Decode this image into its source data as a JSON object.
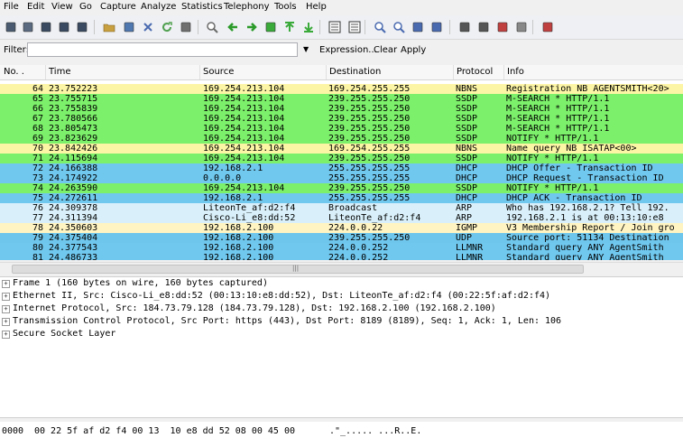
{
  "menu": [
    "File",
    "Edit",
    "View",
    "Go",
    "Capture",
    "Analyze",
    "Statistics",
    "Telephony",
    "Tools",
    "Help"
  ],
  "toolbar_icons": [
    "interfaces-icon",
    "options-icon",
    "start-capture-icon",
    "stop-capture-icon",
    "restart-capture-icon",
    "open-file-icon",
    "save-file-icon",
    "close-file-icon",
    "reload-icon",
    "print-icon",
    "find-packet-icon",
    "go-back-icon",
    "go-forward-icon",
    "go-to-packet-icon",
    "go-first-icon",
    "go-last-icon",
    "colorize-icon",
    "auto-scroll-icon",
    "zoom-in-icon",
    "zoom-out-icon",
    "normal-size-icon",
    "resize-columns-icon",
    "capture-filters-icon",
    "display-filters-icon",
    "coloring-rules-icon",
    "preferences-icon",
    "help-icon"
  ],
  "filter": {
    "label": "Filter:",
    "value": "",
    "expression_label": "Expression...",
    "clear_label": "Clear",
    "apply_label": "Apply"
  },
  "columns": {
    "no": "No. .",
    "time": "Time",
    "source": "Source",
    "destination": "Destination",
    "protocol": "Protocol",
    "info": "Info"
  },
  "colors": {
    "nbns": "#fdf5a6",
    "ssdp": "#7cf06a",
    "dhcp": "#70c8ef",
    "arp": "#d9f0fa",
    "igmp": "#fff4c2",
    "udp": "#6fc6ec",
    "llmnr": "#70c8ef",
    "partial": "#e8e8ff"
  },
  "packets": [
    {
      "no": "64",
      "time": "23.752223",
      "src": "169.254.213.104",
      "dst": "169.254.255.255",
      "proto": "NBNS",
      "info": "Registration NB AGENTSMITH<20>",
      "color": "#fdf5a6"
    },
    {
      "no": "65",
      "time": "23.755715",
      "src": "169.254.213.104",
      "dst": "239.255.255.250",
      "proto": "SSDP",
      "info": "M-SEARCH * HTTP/1.1",
      "color": "#7cf06a"
    },
    {
      "no": "66",
      "time": "23.755839",
      "src": "169.254.213.104",
      "dst": "239.255.255.250",
      "proto": "SSDP",
      "info": "M-SEARCH * HTTP/1.1",
      "color": "#7cf06a"
    },
    {
      "no": "67",
      "time": "23.780566",
      "src": "169.254.213.104",
      "dst": "239.255.255.250",
      "proto": "SSDP",
      "info": "M-SEARCH * HTTP/1.1",
      "color": "#7cf06a"
    },
    {
      "no": "68",
      "time": "23.805473",
      "src": "169.254.213.104",
      "dst": "239.255.255.250",
      "proto": "SSDP",
      "info": "M-SEARCH * HTTP/1.1",
      "color": "#7cf06a"
    },
    {
      "no": "69",
      "time": "23.823629",
      "src": "169.254.213.104",
      "dst": "239.255.255.250",
      "proto": "SSDP",
      "info": "NOTIFY * HTTP/1.1",
      "color": "#7cf06a"
    },
    {
      "no": "70",
      "time": "23.842426",
      "src": "169.254.213.104",
      "dst": "169.254.255.255",
      "proto": "NBNS",
      "info": "Name query NB ISATAP<00>",
      "color": "#fdf5a6"
    },
    {
      "no": "71",
      "time": "24.115694",
      "src": "169.254.213.104",
      "dst": "239.255.255.250",
      "proto": "SSDP",
      "info": "NOTIFY * HTTP/1.1",
      "color": "#7cf06a"
    },
    {
      "no": "72",
      "time": "24.166388",
      "src": "192.168.2.1",
      "dst": "255.255.255.255",
      "proto": "DHCP",
      "info": "DHCP Offer    - Transaction ID",
      "color": "#70c8ef"
    },
    {
      "no": "73",
      "time": "24.174922",
      "src": "0.0.0.0",
      "dst": "255.255.255.255",
      "proto": "DHCP",
      "info": "DHCP Request  - Transaction ID",
      "color": "#70c8ef"
    },
    {
      "no": "74",
      "time": "24.263590",
      "src": "169.254.213.104",
      "dst": "239.255.255.250",
      "proto": "SSDP",
      "info": "NOTIFY * HTTP/1.1",
      "color": "#7cf06a"
    },
    {
      "no": "75",
      "time": "24.272611",
      "src": "192.168.2.1",
      "dst": "255.255.255.255",
      "proto": "DHCP",
      "info": "DHCP ACK      - Transaction ID",
      "color": "#70c8ef"
    },
    {
      "no": "76",
      "time": "24.309378",
      "src": "LiteonTe_af:d2:f4",
      "dst": "Broadcast",
      "proto": "ARP",
      "info": "Who has 192.168.2.1?  Tell 192.",
      "color": "#d9f0fa"
    },
    {
      "no": "77",
      "time": "24.311394",
      "src": "Cisco-Li_e8:dd:52",
      "dst": "LiteonTe_af:d2:f4",
      "proto": "ARP",
      "info": "192.168.2.1 is at 00:13:10:e8",
      "color": "#d9f0fa"
    },
    {
      "no": "78",
      "time": "24.350603",
      "src": "192.168.2.100",
      "dst": "224.0.0.22",
      "proto": "IGMP",
      "info": "V3 Membership Report / Join gro",
      "color": "#fff4c2"
    },
    {
      "no": "79",
      "time": "24.375404",
      "src": "192.168.2.100",
      "dst": "239.255.255.250",
      "proto": "UDP",
      "info": "Source port: 51134  Destination",
      "color": "#6fc6ec"
    },
    {
      "no": "80",
      "time": "24.377543",
      "src": "192.168.2.100",
      "dst": "224.0.0.252",
      "proto": "LLMNR",
      "info": "Standard query ANY AgentSmith",
      "color": "#70c8ef"
    },
    {
      "no": "81",
      "time": "24.486733",
      "src": "192.168.2.100",
      "dst": "224.0.0.252",
      "proto": "LLMNR",
      "info": "Standard query ANY AgentSmith",
      "color": "#70c8ef"
    }
  ],
  "details": [
    "Frame 1 (160 bytes on wire, 160 bytes captured)",
    "Ethernet II, Src: Cisco-Li_e8:dd:52 (00:13:10:e8:dd:52), Dst: LiteonTe_af:d2:f4 (00:22:5f:af:d2:f4)",
    "Internet Protocol, Src: 184.73.79.128 (184.73.79.128), Dst: 192.168.2.100 (192.168.2.100)",
    "Transmission Control Protocol, Src Port: https (443), Dst Port: 8189 (8189), Seq: 1, Ack: 1, Len: 106",
    "Secure Socket Layer"
  ],
  "bytes": {
    "offset": "0000",
    "hex": "00 22 5f af d2 f4 00 13  10 e8 dd 52 08 00 45 00",
    "ascii": ".\"_..... ...R..E."
  }
}
